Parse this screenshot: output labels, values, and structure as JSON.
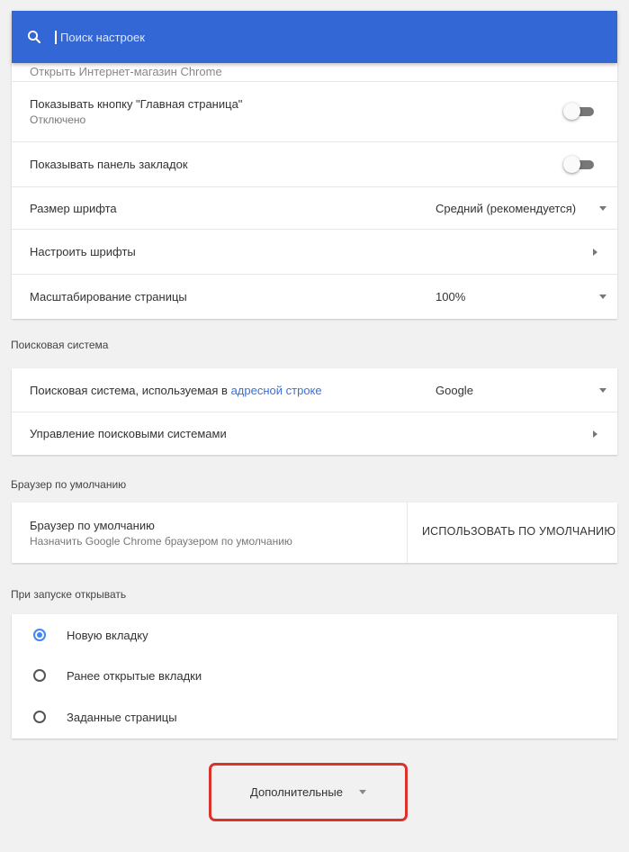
{
  "search": {
    "placeholder": "Поиск настроек"
  },
  "appearance": {
    "partial_row": "Открыть Интернет-магазин Chrome",
    "home_button": {
      "label": "Показывать кнопку \"Главная страница\"",
      "sub": "Отключено",
      "enabled": false
    },
    "bookmarks_bar": {
      "label": "Показывать панель закладок",
      "enabled": false
    },
    "font_size": {
      "label": "Размер шрифта",
      "value": "Средний (рекомендуется)"
    },
    "customize_fonts": {
      "label": "Настроить шрифты"
    },
    "page_zoom": {
      "label": "Масштабирование страницы",
      "value": "100%"
    }
  },
  "search_engine": {
    "title": "Поисковая система",
    "engine_row": {
      "label_prefix": "Поисковая система, используемая в ",
      "label_link": "адресной строке",
      "value": "Google"
    },
    "manage": {
      "label": "Управление поисковыми системами"
    }
  },
  "default_browser": {
    "title": "Браузер по умолчанию",
    "row": {
      "label": "Браузер по умолчанию",
      "sub": "Назначить Google Chrome браузером по умолчанию"
    },
    "button": "ИСПОЛЬЗОВАТЬ ПО УМОЛЧАНИЮ"
  },
  "on_startup": {
    "title": "При запуске открывать",
    "options": [
      {
        "label": "Новую вкладку",
        "selected": true
      },
      {
        "label": "Ранее открытые вкладки",
        "selected": false
      },
      {
        "label": "Заданные страницы",
        "selected": false
      }
    ]
  },
  "advanced": {
    "label": "Дополнительные"
  },
  "colors": {
    "header": "#3367d6",
    "accent": "#4285f4",
    "highlight": "#d9332c"
  }
}
